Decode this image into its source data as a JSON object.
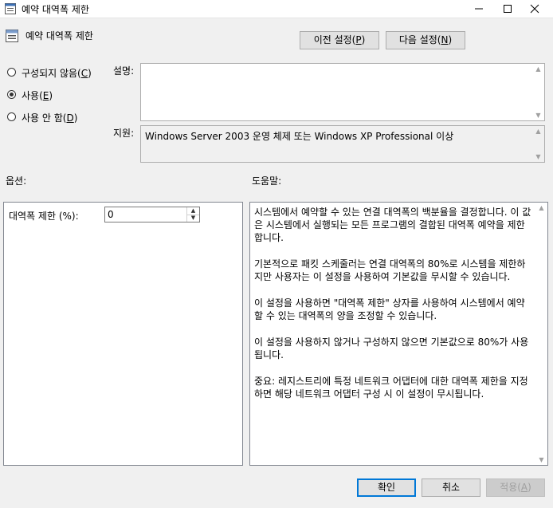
{
  "window": {
    "title": "예약 대역폭 제한",
    "colors": {
      "titlebar_bg": "#ffffff",
      "body_bg": "#f0f0f0",
      "accent": "#0078d7"
    }
  },
  "header": {
    "title": "예약 대역폭 제한",
    "prev_setting": {
      "label": "이전 설정(",
      "key": "P",
      "suffix": ")"
    },
    "next_setting": {
      "label": "다음 설정(",
      "key": "N",
      "suffix": ")"
    }
  },
  "state_options": [
    {
      "label": "구성되지 않음(",
      "key": "C",
      "suffix": ")",
      "selected": false
    },
    {
      "label": "사용(",
      "key": "E",
      "suffix": ")",
      "selected": true
    },
    {
      "label": "사용 안 함(",
      "key": "D",
      "suffix": ")",
      "selected": false
    }
  ],
  "comment": {
    "label": "설명:",
    "value": ""
  },
  "supported_on": {
    "label": "지원:",
    "value": "Windows Server 2003 운영 체제 또는 Windows XP Professional 이상"
  },
  "options": {
    "heading": "옵션:",
    "bandwidth_limit": {
      "label": "대역폭 제한 (%):",
      "value": "0"
    }
  },
  "help": {
    "heading": "도움말:",
    "paragraphs": [
      "시스템에서 예약할 수 있는 연결 대역폭의 백분율을 결정합니다. 이 값은 시스템에서 실행되는 모든 프로그램의 결합된 대역폭 예약을 제한합니다.",
      "기본적으로 패킷 스케줄러는 연결 대역폭의 80%로 시스템을 제한하지만 사용자는 이 설정을 사용하여 기본값을 무시할 수 있습니다.",
      "이 설정을 사용하면 \"대역폭 제한\" 상자를 사용하여 시스템에서 예약할 수 있는 대역폭의 양을 조정할 수 있습니다.",
      "이 설정을 사용하지 않거나 구성하지 않으면 기본값으로 80%가 사용됩니다.",
      "중요: 레지스트리에 특정 네트워크 어댑터에 대한 대역폭 제한을 지정하면 해당 네트워크 어댑터 구성 시 이 설정이 무시됩니다."
    ]
  },
  "footer": {
    "ok": "확인",
    "cancel": "취소",
    "apply": {
      "label": "적용(",
      "key": "A",
      "suffix": ")"
    }
  }
}
